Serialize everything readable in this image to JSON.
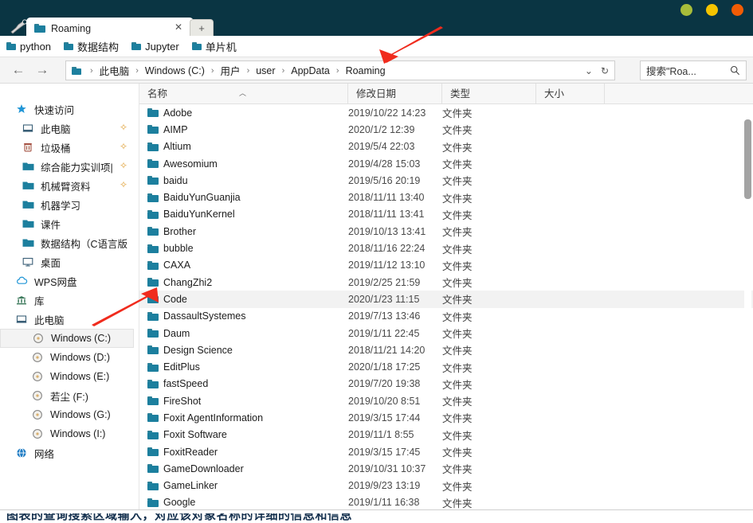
{
  "window": {
    "controls": [
      {
        "name": "minimize",
        "color": "#a8bd3a"
      },
      {
        "name": "maximize",
        "color": "#f5c400"
      },
      {
        "name": "close",
        "color": "#f25c05"
      }
    ],
    "titlebar_color": "#0a3543"
  },
  "tabs": {
    "active": "Roaming",
    "close_glyph": "✕",
    "new_tab_glyph": "+",
    "tool_icon": "wrench-icon"
  },
  "bookmarks": [
    {
      "label": "python"
    },
    {
      "label": "数据结构"
    },
    {
      "label": "Jupyter"
    },
    {
      "label": "单片机"
    }
  ],
  "nav": {
    "back_glyph": "←",
    "forward_glyph": "→",
    "breadcrumb": [
      "此电脑",
      "Windows (C:)",
      "用户",
      "user",
      "AppData",
      "Roaming"
    ],
    "separator": "›",
    "dropdown_glyph": "⌄",
    "refresh_glyph": "↻"
  },
  "search": {
    "value": "搜索\"Roa...",
    "icon": "search-icon"
  },
  "sidebar": [
    {
      "label": "快速访问",
      "icon": "star-icon",
      "level": 0,
      "pinned": false,
      "selected": false
    },
    {
      "label": "此电脑",
      "icon": "computer-icon",
      "level": 1,
      "pinned": true,
      "selected": false
    },
    {
      "label": "垃圾桶",
      "icon": "recycle-bin-icon",
      "level": 1,
      "pinned": true,
      "selected": false
    },
    {
      "label": "综合能力实训项|",
      "icon": "folder-icon",
      "level": 1,
      "pinned": true,
      "selected": false
    },
    {
      "label": "机械臂资料",
      "icon": "folder-icon",
      "level": 1,
      "pinned": true,
      "selected": false
    },
    {
      "label": "机器学习",
      "icon": "folder-icon",
      "level": 1,
      "pinned": false,
      "selected": false
    },
    {
      "label": "课件",
      "icon": "folder-icon",
      "level": 1,
      "pinned": false,
      "selected": false
    },
    {
      "label": "数据结构（C语言版",
      "icon": "folder-icon",
      "level": 1,
      "pinned": false,
      "selected": false
    },
    {
      "label": "桌面",
      "icon": "desktop-icon",
      "level": 1,
      "pinned": false,
      "selected": false
    },
    {
      "label": "WPS网盘",
      "icon": "cloud-icon",
      "level": 0,
      "pinned": false,
      "selected": false
    },
    {
      "label": "库",
      "icon": "library-icon",
      "level": 0,
      "pinned": false,
      "selected": false
    },
    {
      "label": "此电脑",
      "icon": "computer-icon",
      "level": 0,
      "pinned": false,
      "selected": false
    },
    {
      "label": "Windows (C:)",
      "icon": "drive-icon",
      "level": 2,
      "pinned": false,
      "selected": true
    },
    {
      "label": "Windows (D:)",
      "icon": "drive-icon",
      "level": 2,
      "pinned": false,
      "selected": false
    },
    {
      "label": "Windows (E:)",
      "icon": "drive-icon",
      "level": 2,
      "pinned": false,
      "selected": false
    },
    {
      "label": "若尘 (F:)",
      "icon": "drive-icon",
      "level": 2,
      "pinned": false,
      "selected": false
    },
    {
      "label": "Windows (G:)",
      "icon": "drive-icon",
      "level": 2,
      "pinned": false,
      "selected": false
    },
    {
      "label": "Windows (I:)",
      "icon": "drive-icon",
      "level": 2,
      "pinned": false,
      "selected": false
    },
    {
      "label": "网络",
      "icon": "network-icon",
      "level": 0,
      "pinned": false,
      "selected": false
    }
  ],
  "columns": [
    {
      "key": "name",
      "label": "名称",
      "sorted": "asc"
    },
    {
      "key": "date",
      "label": "修改日期",
      "sorted": null
    },
    {
      "key": "type",
      "label": "类型",
      "sorted": null
    },
    {
      "key": "size",
      "label": "大小",
      "sorted": null
    }
  ],
  "sort_caret": "︿",
  "files": [
    {
      "name": "Adobe",
      "date": "2019/10/22 14:23",
      "type": "文件夹",
      "size": "",
      "hover": false
    },
    {
      "name": "AIMP",
      "date": "2020/1/2 12:39",
      "type": "文件夹",
      "size": "",
      "hover": false
    },
    {
      "name": "Altium",
      "date": "2019/5/4 22:03",
      "type": "文件夹",
      "size": "",
      "hover": false
    },
    {
      "name": "Awesomium",
      "date": "2019/4/28 15:03",
      "type": "文件夹",
      "size": "",
      "hover": false
    },
    {
      "name": "baidu",
      "date": "2019/5/16 20:19",
      "type": "文件夹",
      "size": "",
      "hover": false
    },
    {
      "name": "BaiduYunGuanjia",
      "date": "2018/11/11 13:40",
      "type": "文件夹",
      "size": "",
      "hover": false
    },
    {
      "name": "BaiduYunKernel",
      "date": "2018/11/11 13:41",
      "type": "文件夹",
      "size": "",
      "hover": false
    },
    {
      "name": "Brother",
      "date": "2019/10/13 13:41",
      "type": "文件夹",
      "size": "",
      "hover": false
    },
    {
      "name": "bubble",
      "date": "2018/11/16 22:24",
      "type": "文件夹",
      "size": "",
      "hover": false
    },
    {
      "name": "CAXA",
      "date": "2019/11/12 13:10",
      "type": "文件夹",
      "size": "",
      "hover": false
    },
    {
      "name": "ChangZhi2",
      "date": "2019/2/25 21:59",
      "type": "文件夹",
      "size": "",
      "hover": false
    },
    {
      "name": "Code",
      "date": "2020/1/23 11:15",
      "type": "文件夹",
      "size": "",
      "hover": true
    },
    {
      "name": "DassaultSystemes",
      "date": "2019/7/13 13:46",
      "type": "文件夹",
      "size": "",
      "hover": false
    },
    {
      "name": "Daum",
      "date": "2019/1/11 22:45",
      "type": "文件夹",
      "size": "",
      "hover": false
    },
    {
      "name": "Design Science",
      "date": "2018/11/21 14:20",
      "type": "文件夹",
      "size": "",
      "hover": false
    },
    {
      "name": "EditPlus",
      "date": "2020/1/18 17:25",
      "type": "文件夹",
      "size": "",
      "hover": false
    },
    {
      "name": "fastSpeed",
      "date": "2019/7/20 19:38",
      "type": "文件夹",
      "size": "",
      "hover": false
    },
    {
      "name": "FireShot",
      "date": "2019/10/20 8:51",
      "type": "文件夹",
      "size": "",
      "hover": false
    },
    {
      "name": "Foxit AgentInformation",
      "date": "2019/3/15 17:44",
      "type": "文件夹",
      "size": "",
      "hover": false
    },
    {
      "name": "Foxit Software",
      "date": "2019/11/1 8:55",
      "type": "文件夹",
      "size": "",
      "hover": false
    },
    {
      "name": "FoxitReader",
      "date": "2019/3/15 17:45",
      "type": "文件夹",
      "size": "",
      "hover": false
    },
    {
      "name": "GameDownloader",
      "date": "2019/10/31 10:37",
      "type": "文件夹",
      "size": "",
      "hover": false
    },
    {
      "name": "GameLinker",
      "date": "2019/9/23 13:19",
      "type": "文件夹",
      "size": "",
      "hover": false
    },
    {
      "name": "Google",
      "date": "2019/1/11 16:38",
      "type": "文件夹",
      "size": "",
      "hover": false
    }
  ],
  "annotations": [
    {
      "name": "arrow-to-address-bar",
      "color": "#f02b1d"
    },
    {
      "name": "arrow-to-code-folder",
      "color": "#f02b1d"
    }
  ],
  "bottom_strip": {
    "text": "图表的查询搜索区域输入，对应该对象名称的详细的信息和信息"
  }
}
